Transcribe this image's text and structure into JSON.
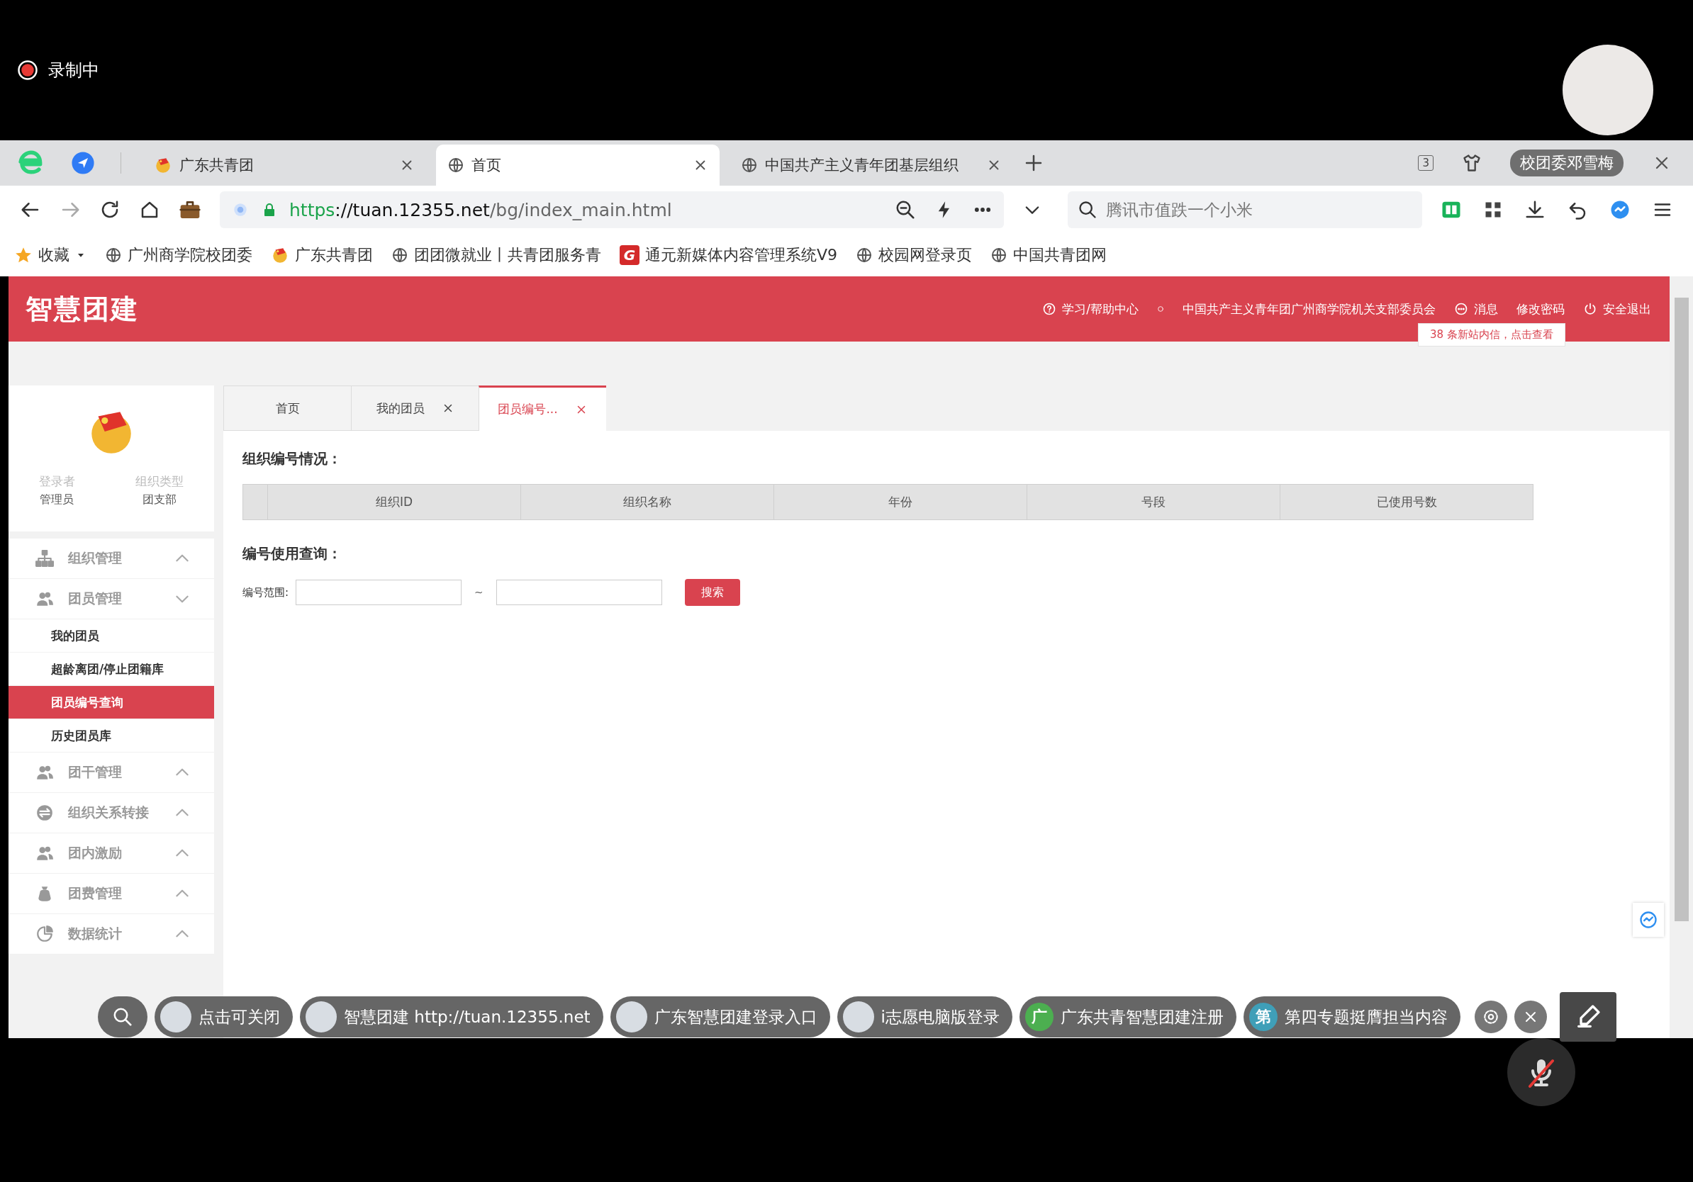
{
  "recording": {
    "label": "录制中"
  },
  "browser": {
    "tabs": [
      {
        "title": "广东共青团",
        "kind": "emblem",
        "selected": false
      },
      {
        "title": "首页",
        "kind": "globe",
        "selected": true
      },
      {
        "title": "中国共产主义青年团基层组织",
        "kind": "globe",
        "selected": false
      }
    ],
    "tab_count": "3",
    "user_tag": "校团委邓雪梅",
    "address": {
      "url_scheme": "https",
      "url_host": "://tuan.12355.net",
      "url_path": "/bg/index_main.html"
    },
    "search": {
      "placeholder": "腾讯市值跌一个小米"
    },
    "bookmarks": [
      {
        "label": "收藏",
        "kind": "star"
      },
      {
        "label": "广州商学院校团委",
        "kind": "globe"
      },
      {
        "label": "广东共青团",
        "kind": "emblem"
      },
      {
        "label": "团团微就业丨共青团服务青",
        "kind": "globe"
      },
      {
        "label": "通元新媒体内容管理系统V9",
        "kind": "letter-g",
        "letter": "G"
      },
      {
        "label": "校园网登录页",
        "kind": "globe"
      },
      {
        "label": "中国共青团网",
        "kind": "globe"
      }
    ]
  },
  "site": {
    "logo": "智慧团建",
    "header_links": [
      {
        "label": "学习/帮助中心",
        "kind": "help"
      },
      {
        "label": "中国共产主义青年团广州商学院机关支部委员会",
        "kind": "plain"
      },
      {
        "label": "消息",
        "kind": "message"
      },
      {
        "label": "修改密码",
        "kind": "plain"
      },
      {
        "label": "安全退出",
        "kind": "logout"
      }
    ],
    "notice": "38 条新站内信，点击查看",
    "profile": {
      "fields": [
        {
          "label": "登录者",
          "value": "管理员"
        },
        {
          "label": "组织类型",
          "value": "团支部"
        }
      ]
    },
    "menu": [
      {
        "label": "组织管理",
        "expanded": false
      },
      {
        "label": "团员管理",
        "expanded": true,
        "children": [
          {
            "label": "我的团员",
            "selected": false
          },
          {
            "label": "超龄离团/停止团籍库",
            "selected": false
          },
          {
            "label": "团员编号查询",
            "selected": true
          },
          {
            "label": "历史团员库",
            "selected": false
          }
        ]
      },
      {
        "label": "团干管理",
        "expanded": false
      },
      {
        "label": "组织关系转接",
        "expanded": false
      },
      {
        "label": "团内激励",
        "expanded": false
      },
      {
        "label": "团费管理",
        "expanded": false
      },
      {
        "label": "数据统计",
        "expanded": false
      }
    ],
    "content_tabs": [
      {
        "label": "首页",
        "selected": false,
        "closable": false
      },
      {
        "label": "我的团员",
        "selected": false,
        "closable": true
      },
      {
        "label": "团员编号...",
        "selected": true,
        "closable": true
      }
    ],
    "org_numbers": {
      "title": "组织编号情况：",
      "columns": [
        "组织ID",
        "组织名称",
        "年份",
        "号段",
        "已使用号数"
      ]
    },
    "number_query": {
      "title": "编号使用查询：",
      "range_label": "编号范围:",
      "separator": "~",
      "search_button": "搜索"
    }
  },
  "quick_links": [
    {
      "label": "点击可关闭",
      "kind": "photo"
    },
    {
      "label": "智慧团建 http://tuan.12355.net",
      "kind": "photo"
    },
    {
      "label": "广东智慧团建登录入口",
      "kind": "photo"
    },
    {
      "label": "i志愿电脑版登录",
      "kind": "photo"
    },
    {
      "label": "广东共青智慧团建注册",
      "kind": "letter",
      "letter": "广",
      "color": "#4caf50"
    },
    {
      "label": "第四专题挺膺担当内容",
      "kind": "letter",
      "letter": "第",
      "color": "#3f9fb8"
    }
  ]
}
